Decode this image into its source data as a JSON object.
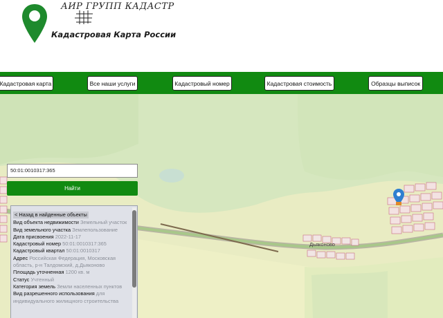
{
  "logo": {
    "script_text": "АИР ГРУПП КАДАСТР",
    "title": "Кадастровая Карта России",
    "pin_color": "#1e8a2d"
  },
  "nav": {
    "items": [
      {
        "label": "Кадастровая карта"
      },
      {
        "label": "Все наши услуги"
      },
      {
        "label": "Кадастровый номер"
      },
      {
        "label": "Кадастровая стоимость"
      },
      {
        "label": "Образцы выписок"
      }
    ],
    "bar_color": "#118a11"
  },
  "search": {
    "value": "50:01:0010317:365",
    "button_label": "Найти"
  },
  "info": {
    "back_label": "< Назад в найденные объекты",
    "rows": [
      {
        "label": "Вид объекта недвижимости",
        "value": "Земельный участок"
      },
      {
        "label": "Вид земельного участка",
        "value": "Землепользование"
      },
      {
        "label": "Дата присвоения",
        "value": "2022-11-17"
      },
      {
        "label": "Кадастровый номер",
        "value": "50:01:0010317:365"
      },
      {
        "label": "Кадастровый квартал",
        "value": "50:01:0010317"
      },
      {
        "label": "Адрес",
        "value": "Российская Федерация, Московская область, р-н Талдомский, д.Дьяконово"
      },
      {
        "label": "Площадь уточненная",
        "value": "1200 кв. м"
      },
      {
        "label": "Статус",
        "value": "Учтенный"
      },
      {
        "label": "Категория земель",
        "value": "Земли населенных пунктов"
      },
      {
        "label": "Вид разрешенного использования",
        "value": "для индивидуального жилищного строительства"
      }
    ]
  },
  "map": {
    "village_label": "Дьяконово",
    "marker_color": "#2f7fd0"
  }
}
